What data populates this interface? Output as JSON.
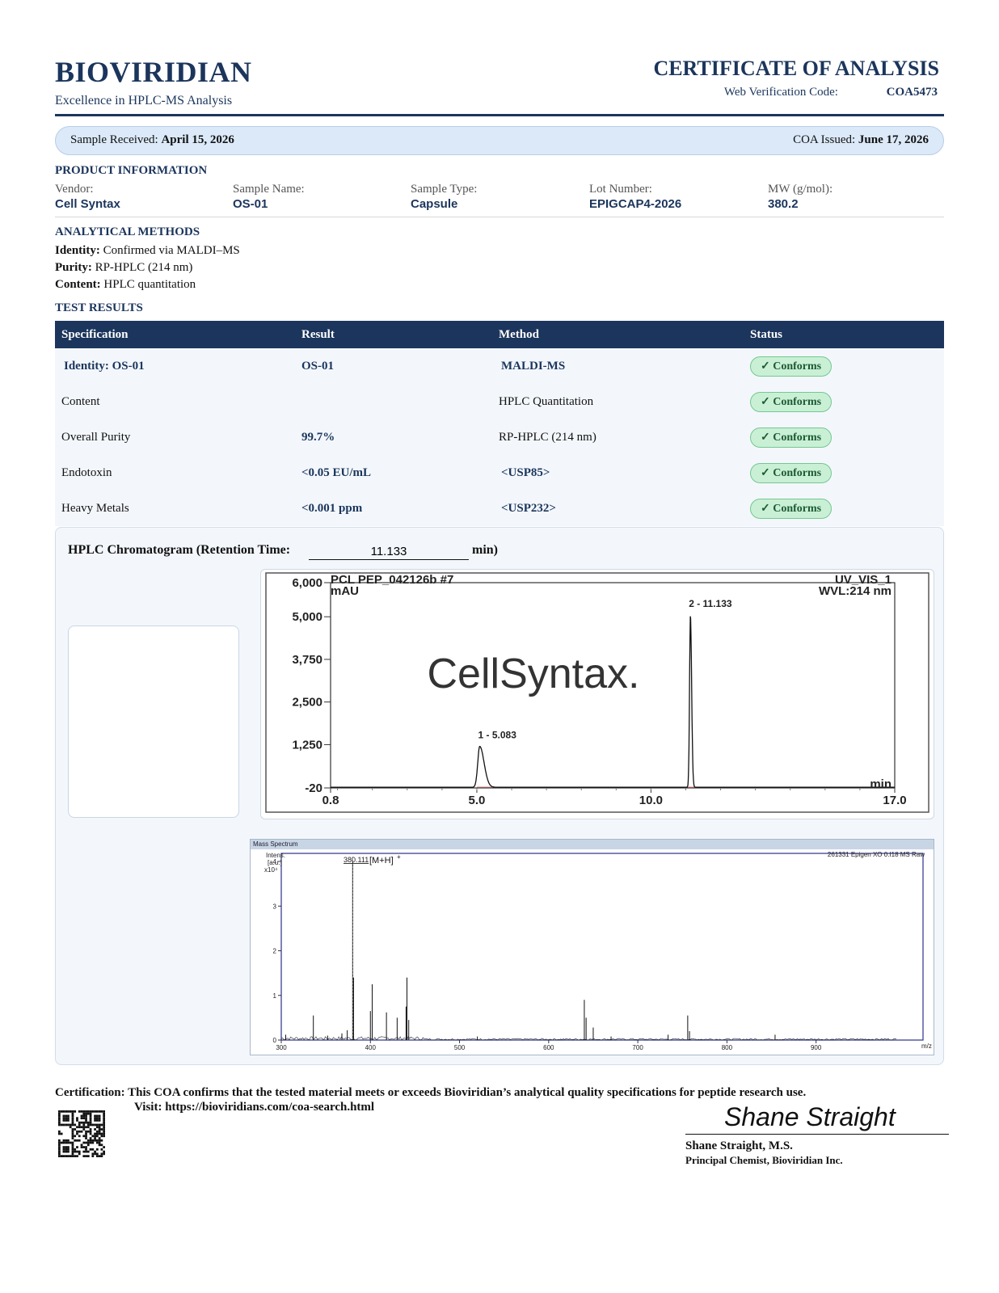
{
  "header": {
    "brand": "BIOVIRIDIAN",
    "tagline": "Excellence in HPLC-MS Analysis",
    "doc_title": "CERTIFICATE OF ANALYSIS",
    "verification_label": "Web Verification Code:",
    "verification_code": "COA5473"
  },
  "dates": {
    "received_label": "Sample Received:",
    "received_value": "April 15, 2026",
    "issued_label": "COA Issued:",
    "issued_value": "June 17, 2026"
  },
  "product_info": {
    "heading": "PRODUCT INFORMATION",
    "fields": [
      {
        "label": "Vendor:",
        "value": "Cell Syntax"
      },
      {
        "label": "Sample Name:",
        "value": "OS-01"
      },
      {
        "label": "Sample Type:",
        "value": "Capsule"
      },
      {
        "label": "Lot Number:",
        "value": "EPIGCAP4-2026"
      },
      {
        "label": "MW (g/mol):",
        "value": "380.2"
      }
    ]
  },
  "methods": {
    "heading": "ANALYTICAL METHODS",
    "items": [
      {
        "label": "Identity:",
        "value": "Confirmed via MALDI–MS"
      },
      {
        "label": "Purity:",
        "value": "RP-HPLC (214 nm)"
      },
      {
        "label": "Content:",
        "value": "HPLC quantitation"
      }
    ]
  },
  "results": {
    "heading": "TEST RESULTS",
    "columns": [
      "Specification",
      "Result",
      "Method",
      "Status"
    ],
    "rows": [
      {
        "spec": "Identity:  OS-01",
        "result": "OS-01",
        "method": "MALDI-MS",
        "status": "✓ Conforms"
      },
      {
        "spec": "Content",
        "result": "",
        "method": "HPLC Quantitation",
        "status": "✓ Conforms"
      },
      {
        "spec": "Overall Purity",
        "result": "99.7%",
        "method": "RP-HPLC (214 nm)",
        "status": "✓ Conforms"
      },
      {
        "spec": "Endotoxin",
        "result": "<0.05 EU/mL",
        "method": "<USP85>",
        "status": "✓ Conforms"
      },
      {
        "spec": "Heavy Metals",
        "result": "<0.001 ppm",
        "method": "<USP232>",
        "status": "✓ Conforms"
      }
    ]
  },
  "chromatogram": {
    "label_prefix": "HPLC Chromatogram (Retention Time:",
    "retention_time": "11.133",
    "label_suffix": "min)",
    "watermark": "CellSyntax."
  },
  "chart_data": [
    {
      "type": "line",
      "title": "PCL PEP_042126b #7",
      "subtitle_right": [
        "UV_VIS_1",
        "WVL:214 nm"
      ],
      "ylabel": "mAU",
      "xlabel": "min",
      "xlim": [
        0.8,
        17.0
      ],
      "ylim": [
        -20,
        6000
      ],
      "x_ticks": [
        "0.8",
        "5.0",
        "10.0",
        "17.0"
      ],
      "y_ticks": [
        "6,000",
        "5,000",
        "3,750",
        "2,500",
        "1,250",
        "-20"
      ],
      "peaks": [
        {
          "label": "1 - 5.083",
          "x": 5.083,
          "y": 1200
        },
        {
          "label": "2 - 11.133",
          "x": 11.133,
          "y": 5050
        }
      ]
    },
    {
      "type": "line",
      "panel_title": "Mass Spectrum",
      "ylabel": [
        "Intens.",
        "[a.u.]",
        "x10⁴"
      ],
      "xlabel": "m/z",
      "source_label": "261331 Epigen XO 0.I18 MS Raw",
      "xlim": [
        300,
        1000
      ],
      "ylim": [
        0,
        4
      ],
      "x_ticks": [
        "300",
        "400",
        "500",
        "600",
        "700",
        "800",
        "900"
      ],
      "y_ticks": [
        "0",
        "1",
        "2",
        "3",
        "4"
      ],
      "annotation": {
        "mz": "380.111",
        "ion": "[M+H]",
        "ion_sup": "+"
      },
      "peaks": [
        {
          "x": 305,
          "y": 0.12
        },
        {
          "x": 336,
          "y": 0.55
        },
        {
          "x": 352,
          "y": 0.1
        },
        {
          "x": 368,
          "y": 0.15
        },
        {
          "x": 374,
          "y": 0.22
        },
        {
          "x": 380.1,
          "y": 4.0
        },
        {
          "x": 381.1,
          "y": 1.4
        },
        {
          "x": 400,
          "y": 0.65
        },
        {
          "x": 402,
          "y": 1.25
        },
        {
          "x": 418,
          "y": 0.62
        },
        {
          "x": 430,
          "y": 0.5
        },
        {
          "x": 440,
          "y": 0.75
        },
        {
          "x": 441,
          "y": 1.4
        },
        {
          "x": 443,
          "y": 0.45
        },
        {
          "x": 520,
          "y": 0.08
        },
        {
          "x": 640,
          "y": 0.9
        },
        {
          "x": 642,
          "y": 0.5
        },
        {
          "x": 650,
          "y": 0.28
        },
        {
          "x": 670,
          "y": 0.08
        },
        {
          "x": 734,
          "y": 0.12
        },
        {
          "x": 756,
          "y": 0.55
        },
        {
          "x": 758,
          "y": 0.2
        },
        {
          "x": 854,
          "y": 0.12
        }
      ]
    }
  ],
  "certification": {
    "label": "Certification:",
    "text": "This COA confirms that the tested material meets or exceeds Bioviridian’s analytical quality specifications for peptide research use.",
    "visit": "Visit: https://bioviridians.com/coa-search.html"
  },
  "signature": {
    "script": "Shane Straight",
    "name": "Shane Straight, M.S.",
    "title": "Principal Chemist, Bioviridian Inc."
  }
}
